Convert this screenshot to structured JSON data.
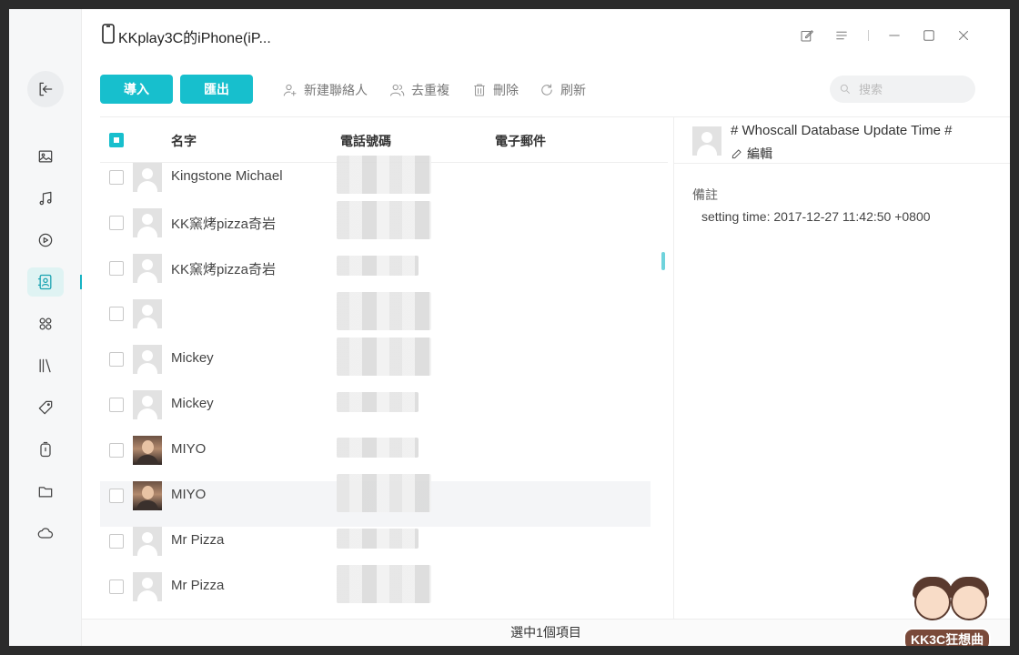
{
  "window": {
    "title": "KKplay3C的iPhone(iP..."
  },
  "sidebar": {
    "items": [
      {
        "icon": "photo-icon",
        "active": false
      },
      {
        "icon": "music-icon",
        "active": false
      },
      {
        "icon": "video-icon",
        "active": false
      },
      {
        "icon": "contacts-icon",
        "active": true
      },
      {
        "icon": "apps-icon",
        "active": false
      },
      {
        "icon": "books-icon",
        "active": false
      },
      {
        "icon": "ringtone-icon",
        "active": false
      },
      {
        "icon": "voice-memo-icon",
        "active": false
      },
      {
        "icon": "folder-icon",
        "active": false
      },
      {
        "icon": "cloud-icon",
        "active": false
      }
    ]
  },
  "toolbar": {
    "import_label": "導入",
    "export_label": "匯出",
    "new_contact_label": "新建聯絡人",
    "dedupe_label": "去重複",
    "delete_label": "刪除",
    "refresh_label": "刷新",
    "search_placeholder": "搜索"
  },
  "table": {
    "columns": [
      "名字",
      "電話號碼",
      "電子郵件"
    ],
    "rows": [
      {
        "name": "Kingstone Michael",
        "photo": false,
        "selected": false
      },
      {
        "name": "KK窯烤pizza奇岩",
        "photo": false,
        "selected": false
      },
      {
        "name": "KK窯烤pizza奇岩",
        "photo": false,
        "selected": false
      },
      {
        "name": "",
        "photo": false,
        "selected": false
      },
      {
        "name": "Mickey",
        "photo": false,
        "selected": false
      },
      {
        "name": "Mickey",
        "photo": false,
        "selected": false
      },
      {
        "name": "MIYO",
        "photo": true,
        "selected": false
      },
      {
        "name": "MIYO",
        "photo": true,
        "selected": true
      },
      {
        "name": "Mr Pizza",
        "photo": false,
        "selected": false
      },
      {
        "name": "Mr Pizza",
        "photo": false,
        "selected": false
      }
    ]
  },
  "detail": {
    "name": "# Whoscall Database Update Time #",
    "edit_label": "編輯",
    "note_label": "備註",
    "note_value": "setting time: 2017-12-27 11:42:50 +0800"
  },
  "status": {
    "selection_text": "選中1個項目"
  },
  "watermark": {
    "text": "KK3C狂想曲"
  },
  "colors": {
    "accent": "#17bfcd",
    "selected_row": "#f4f5f7"
  }
}
